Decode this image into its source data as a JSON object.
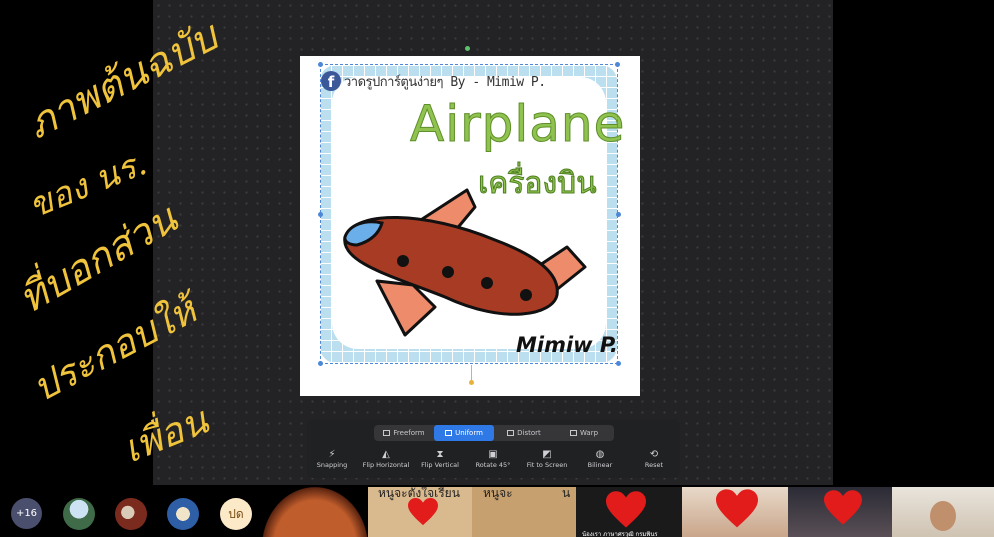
{
  "annotation": {
    "lines": [
      "ภาพต้นฉบับ",
      "ของ นร.",
      "ที่บอกส่วน",
      "ประกอบให้",
      "เพื่อน"
    ],
    "color": "#f0c33c"
  },
  "image_content": {
    "watermark": "วาดรูปการ์ตูนง่ายๆ By - Mimiw P.",
    "title_en": "Airplane",
    "title_th": "เครื่องบิน",
    "artist": "Mimiw P.",
    "facebook_glyph": "f"
  },
  "toolbar": {
    "modes": [
      {
        "label": "Freeform",
        "active": false
      },
      {
        "label": "Uniform",
        "active": true
      },
      {
        "label": "Distort",
        "active": false
      },
      {
        "label": "Warp",
        "active": false
      }
    ],
    "tools": [
      {
        "label": "Snapping",
        "icon": "⚡"
      },
      {
        "label": "Flip Horizontal",
        "icon": "◭"
      },
      {
        "label": "Flip Vertical",
        "icon": "⧗"
      },
      {
        "label": "Rotate 45°",
        "icon": "▣"
      },
      {
        "label": "Fit to Screen",
        "icon": "◩"
      },
      {
        "label": "Bilinear",
        "icon": "◍"
      },
      {
        "label": "Reset",
        "icon": "⟲"
      }
    ],
    "accent": "#2f79e6"
  },
  "participants": {
    "more_count": "+16",
    "initials_avatar": "ปด",
    "tile_captions": [
      "หนูจะตั้งใจเรียน",
      "หนูจะ",
      "น",
      "น้องเรา ภาษาศรวุฒิ กรมพินร"
    ]
  }
}
